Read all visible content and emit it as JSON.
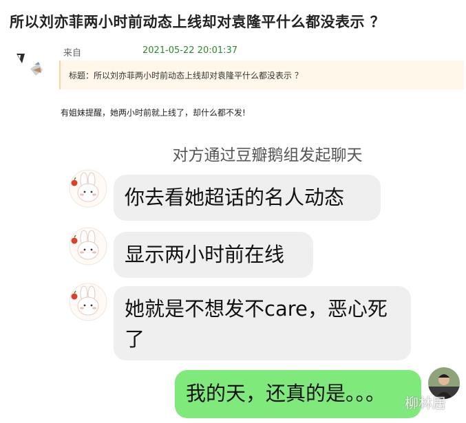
{
  "post": {
    "headline": "所以刘亦菲两小时前动态上线却对袁隆平什么都没表示 ？",
    "from_label": "来自",
    "timestamp": "2021-05-22 20:01:37",
    "title_line": "标题：所以刘亦菲两小时前动态上线却对袁隆平什么都没表示 ？",
    "body": "有姐妹提醒，她两小时前就上线了，却什么都不发!"
  },
  "chat": {
    "system_message": "对方通过豆瓣鹅组发起聊天",
    "messages": [
      {
        "side": "left",
        "text": "你去看她超话的名人动态"
      },
      {
        "side": "left",
        "text": "显示两小时前在线"
      },
      {
        "side": "left",
        "text": "她就是不想发不care，恶心死了"
      },
      {
        "side": "right",
        "text": "我的天，还真的是。。。"
      }
    ]
  },
  "watermark": "柳林居",
  "icons": {
    "post_avatar": "user-avatar-icon",
    "chat_avatar": "bunny-avatar-icon",
    "self_avatar": "user-photo-avatar-icon"
  },
  "colors": {
    "timestamp": "#2a8a2a",
    "incoming_bubble": "#efefef",
    "outgoing_bubble": "#7fea7b",
    "title_box": "#fff8ea"
  }
}
